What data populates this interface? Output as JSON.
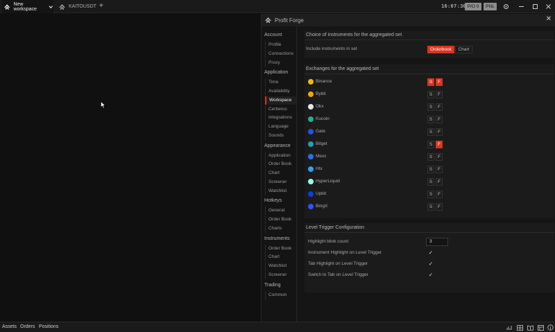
{
  "topbar": {
    "workspace_tab": "New workspace",
    "instrument_tab": "KAITOUSDT",
    "add_tab": "+",
    "clock": "16:07:30",
    "po_label": "P/O 0",
    "pnl_label": "PNL"
  },
  "panel": {
    "title": "Profit Forge",
    "close": "✕"
  },
  "nav": {
    "groups": [
      {
        "label": "Account",
        "items": [
          "Profile",
          "Connections",
          "Proxy"
        ]
      },
      {
        "label": "Application",
        "items": [
          "Time",
          "Availability",
          "Workspace",
          "Cerberus",
          "Integrations",
          "Language",
          "Sounds"
        ]
      },
      {
        "label": "Appearance",
        "items": [
          "Application",
          "Order Book",
          "Chart",
          "Screener",
          "Watchlist"
        ]
      },
      {
        "label": "Hotkeys",
        "items": [
          "General",
          "Order Book",
          "Charts"
        ]
      },
      {
        "label": "Instruments",
        "items": [
          "Order Book",
          "Chart",
          "Watchlist",
          "Screener"
        ]
      },
      {
        "label": "Trading",
        "items": [
          "Common"
        ]
      }
    ],
    "active_item": "Workspace"
  },
  "instruments_section": {
    "title": "Choice of instruments for the aggregated set",
    "include_label": "Include instruments in set",
    "options": [
      "Orderbook",
      "Chart"
    ],
    "selected": "Orderbook"
  },
  "exchanges_section": {
    "title": "Exchanges for the aggregated set",
    "spot_label": "S",
    "futures_label": "F",
    "exchanges": [
      {
        "name": "Binance",
        "spot": true,
        "futures": true,
        "color": "#f0b90b",
        "icon": "binance-icon"
      },
      {
        "name": "Bybit",
        "spot": false,
        "futures": false,
        "color": "#f7a600",
        "icon": "bybit-icon"
      },
      {
        "name": "Okx",
        "spot": false,
        "futures": false,
        "color": "#e6e6e6",
        "icon": "okx-icon"
      },
      {
        "name": "Kucoin",
        "spot": false,
        "futures": false,
        "color": "#23af91",
        "icon": "kucoin-icon"
      },
      {
        "name": "Gate",
        "spot": false,
        "futures": false,
        "color": "#2354e6",
        "icon": "gate-icon"
      },
      {
        "name": "Bitget",
        "spot": false,
        "futures": true,
        "color": "#1da2b4",
        "icon": "bitget-icon"
      },
      {
        "name": "Mexc",
        "spot": false,
        "futures": false,
        "color": "#2a6df4",
        "icon": "mexc-icon"
      },
      {
        "name": "Htx",
        "spot": false,
        "futures": false,
        "color": "#2ea1f2",
        "icon": "htx-icon"
      },
      {
        "name": "HyperLiquid",
        "spot": false,
        "futures": false,
        "color": "#97fce4",
        "icon": "hyperliquid-icon"
      },
      {
        "name": "Upbit",
        "spot": false,
        "futures": false,
        "color": "#0a3cf0",
        "icon": "upbit-icon"
      },
      {
        "name": "BingX",
        "spot": false,
        "futures": false,
        "color": "#2a54ff",
        "icon": "bingx-icon"
      }
    ]
  },
  "level_section": {
    "title": "Level Trigger Configuration",
    "blink_label": "Highlight blink count",
    "blink_value": "3",
    "checks": [
      {
        "label": "Instrument Highlight on Level Trigger",
        "checked": true
      },
      {
        "label": "Tab Highlight on Level Trigger",
        "checked": true
      },
      {
        "label": "Switch to Tab on Level Trigger",
        "checked": true
      }
    ]
  },
  "bottombar": {
    "items": [
      "Assets",
      "Orders",
      "Positions"
    ]
  },
  "colors": {
    "accent": "#d9351f",
    "background": "#101010",
    "panel": "#151515"
  }
}
